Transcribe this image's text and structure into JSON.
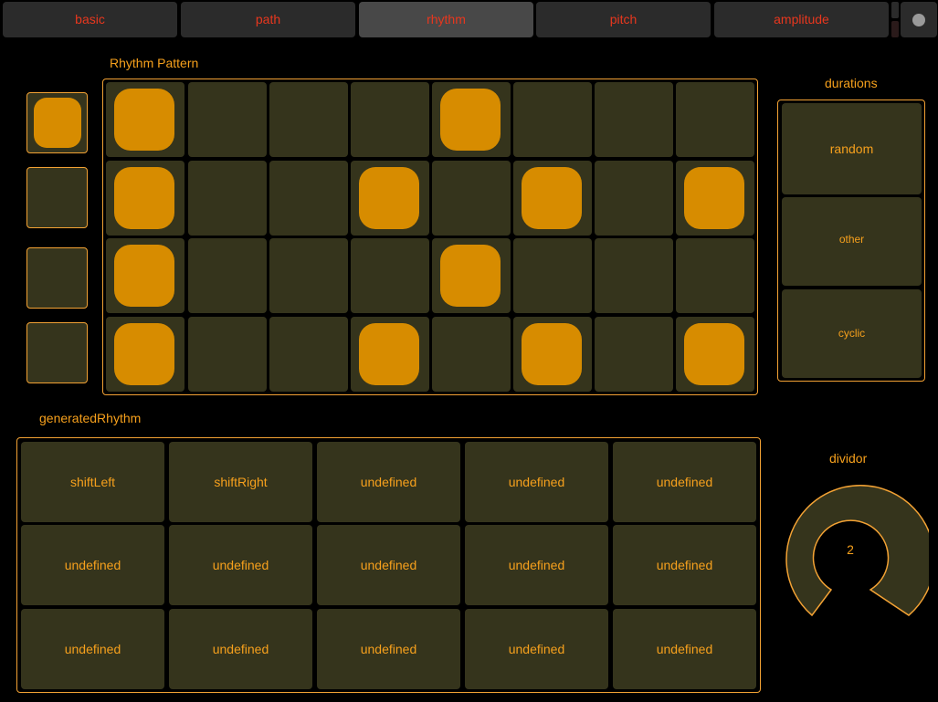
{
  "tabs": [
    {
      "label": "basic",
      "active": false
    },
    {
      "label": "path",
      "active": false
    },
    {
      "label": "rhythm",
      "active": true
    },
    {
      "label": "pitch",
      "active": false
    },
    {
      "label": "amplitude",
      "active": false
    }
  ],
  "rhythm_pattern": {
    "title": "Rhythm Pattern",
    "grid": [
      [
        1,
        0,
        0,
        0,
        1,
        0,
        0,
        0
      ],
      [
        1,
        0,
        0,
        1,
        0,
        1,
        0,
        1
      ],
      [
        1,
        0,
        0,
        0,
        1,
        0,
        0,
        0
      ],
      [
        1,
        0,
        0,
        1,
        0,
        1,
        0,
        1
      ]
    ]
  },
  "row_toggles": [
    1,
    0,
    0,
    0
  ],
  "durations": {
    "title": "durations",
    "options": [
      "random",
      "other",
      "cyclic"
    ]
  },
  "generated_rhythm": {
    "title": "generatedRhythm",
    "cells": [
      [
        "shiftLeft",
        "shiftRight",
        "undefined",
        "undefined",
        "undefined"
      ],
      [
        "undefined",
        "undefined",
        "undefined",
        "undefined",
        "undefined"
      ],
      [
        "undefined",
        "undefined",
        "undefined",
        "undefined",
        "undefined"
      ]
    ]
  },
  "dividor": {
    "title": "dividor",
    "value": "2",
    "accent": "#f3a234"
  },
  "colors": {
    "accent": "#f6a01c",
    "active_pad": "#d78c00",
    "pad_bg": "#35341c",
    "tab_text": "#e8371e"
  }
}
